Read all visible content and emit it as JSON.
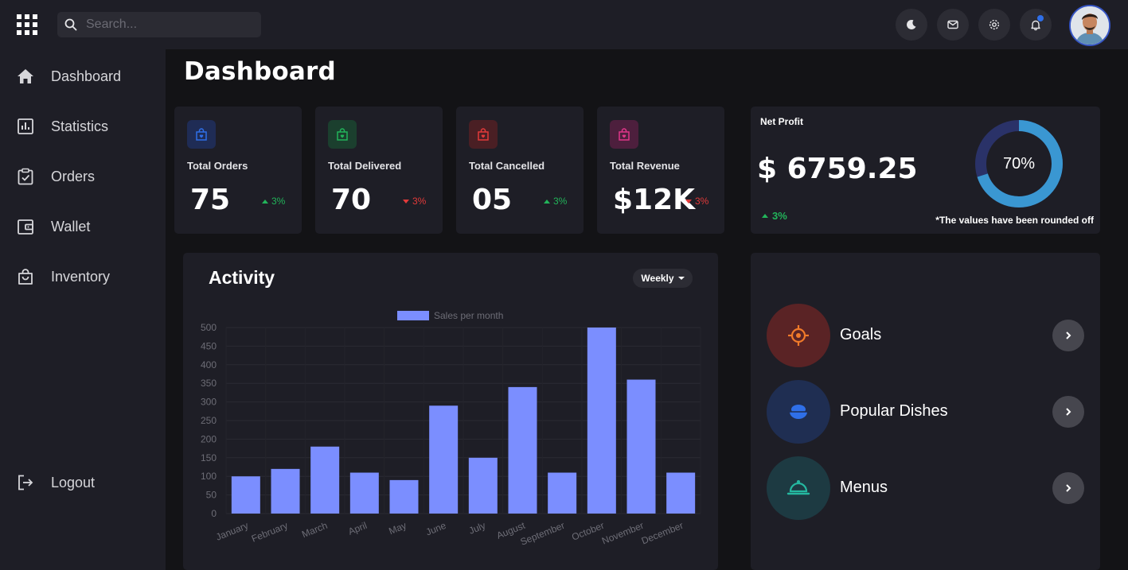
{
  "search": {
    "placeholder": "Search..."
  },
  "sidebar": {
    "items": [
      {
        "label": "Dashboard",
        "icon": "home-icon"
      },
      {
        "label": "Statistics",
        "icon": "statistics-icon"
      },
      {
        "label": "Orders",
        "icon": "clipboard-check-icon"
      },
      {
        "label": "Wallet",
        "icon": "wallet-icon"
      },
      {
        "label": "Inventory",
        "icon": "shopping-bag-icon"
      }
    ],
    "logout": "Logout"
  },
  "page": {
    "title": "Dashboard"
  },
  "stats": [
    {
      "label": "Total Orders",
      "value": "75",
      "trend": "3%",
      "direction": "up",
      "color": "#2f6fe8"
    },
    {
      "label": "Total Delivered",
      "value": "70",
      "trend": "3%",
      "direction": "down",
      "color": "#22b45a"
    },
    {
      "label": "Total Cancelled",
      "value": "05",
      "trend": "3%",
      "direction": "up",
      "color": "#e23a3a"
    },
    {
      "label": "Total Revenue",
      "value": "$12K",
      "trend": "3%",
      "direction": "down",
      "color": "#e0368a"
    }
  ],
  "net_profit": {
    "label": "Net Profit",
    "value": "$ 6759.25",
    "trend": "3%",
    "percent_label": "70%",
    "percent": 70,
    "note": "*The values have been rounded off"
  },
  "activity": {
    "title": "Activity",
    "period": "Weekly"
  },
  "chart_data": {
    "type": "bar",
    "categories": [
      "January",
      "February",
      "March",
      "April",
      "May",
      "June",
      "July",
      "August",
      "September",
      "October",
      "November",
      "December"
    ],
    "series": [
      {
        "name": "Sales per month",
        "values": [
          100,
          120,
          180,
          110,
          90,
          290,
          150,
          340,
          110,
          500,
          360,
          110
        ]
      }
    ],
    "ylim": [
      0,
      500
    ],
    "yticks": [
      0,
      50,
      100,
      150,
      200,
      250,
      300,
      350,
      400,
      450,
      500
    ],
    "grid": true,
    "legend": "top",
    "color": "#7b8eff"
  },
  "quick_access": [
    {
      "label": "Goals",
      "icon": "target-icon",
      "bg": "#5a2325",
      "fg": "#f07a2a"
    },
    {
      "label": "Popular Dishes",
      "icon": "food-bowl-icon",
      "bg": "#1f2e52",
      "fg": "#2f6fe8"
    },
    {
      "label": "Menus",
      "icon": "serving-cloche-icon",
      "bg": "#1d3a42",
      "fg": "#25b7a0"
    }
  ]
}
